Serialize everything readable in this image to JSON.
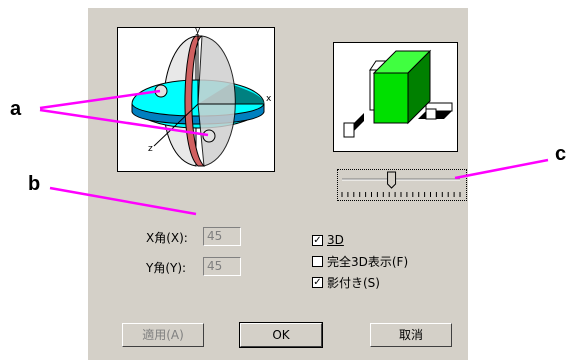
{
  "callouts": {
    "a": "a",
    "b": "b",
    "c": "c"
  },
  "preview": {
    "axis_x": "x",
    "axis_y": "y",
    "axis_z": "z"
  },
  "fields": {
    "x_angle": {
      "label": "X角(X):",
      "value": "45"
    },
    "y_angle": {
      "label": "Y角(Y):",
      "value": "45"
    }
  },
  "options": {
    "three_d": {
      "label": "3D",
      "checked": "✓"
    },
    "full_3d": {
      "label": "完全3D表示(F)",
      "checked": ""
    },
    "shadow": {
      "label": "影付き(S)",
      "checked": "✓"
    }
  },
  "buttons": {
    "apply": "適用(A)",
    "ok": "OK",
    "cancel": "取消"
  },
  "colors": {
    "callout_line": "#ff00ff",
    "dialog_bg": "#d4d0c8",
    "cube": "#00e000",
    "disk": "#00ffff"
  },
  "slider": {
    "position": 0.42
  }
}
